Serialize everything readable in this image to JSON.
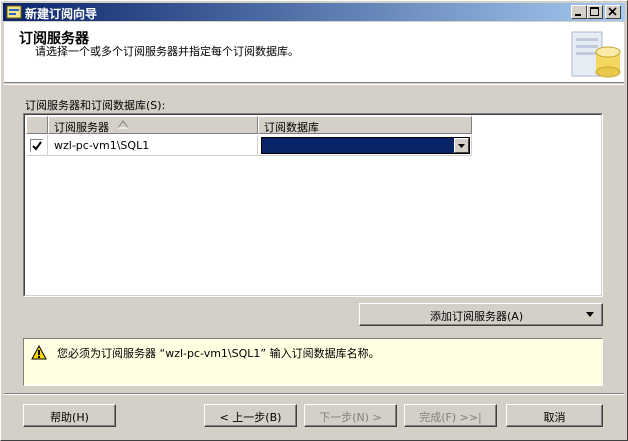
{
  "window": {
    "title": "新建订阅向导",
    "title_icon": "wizard-icon",
    "controls": {
      "minimize": "minimize-icon",
      "maximize": "maximize-icon",
      "close": "close-icon"
    }
  },
  "header": {
    "title": "订阅服务器",
    "subtitle": "请选择一个或多个订阅服务器并指定每个订阅数据库。",
    "icon": "database-server-icon"
  },
  "grid": {
    "label": "订阅服务器和订阅数据库(S):",
    "columns": [
      "订阅服务器",
      "订阅数据库"
    ],
    "sort_icon": "sort-ascending-icon",
    "rows": [
      {
        "checked": true,
        "server": "wzl-pc-vm1\\SQL1",
        "database": ""
      }
    ]
  },
  "add_button": {
    "label": "添加订阅服务器(A)",
    "icon": "dropdown-arrow-icon"
  },
  "message": {
    "icon": "warning-icon",
    "text": "您必须为订阅服务器 “wzl-pc-vm1\\SQL1” 输入订阅数据库名称。"
  },
  "footer": {
    "help": "帮助(H)",
    "back": "< 上一步(B)",
    "next": "下一步(N) >",
    "finish": "完成(F) >>|",
    "cancel": "取消"
  },
  "colors": {
    "title_gradient_start": "#0a246a",
    "title_gradient_end": "#a6caf0",
    "selection": "#0a246a",
    "message_bg": "#ffffe1",
    "face": "#d4d0c8"
  }
}
